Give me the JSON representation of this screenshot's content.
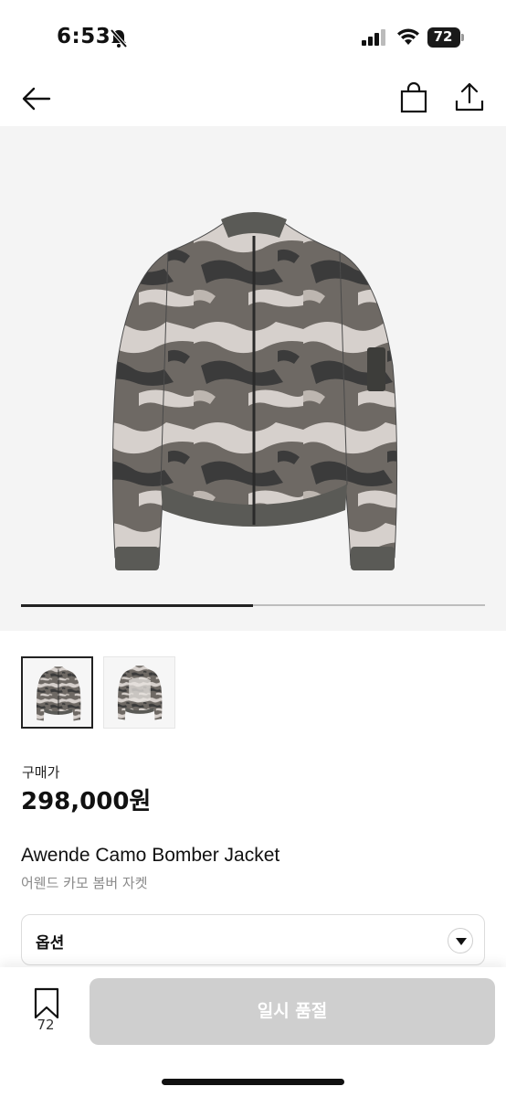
{
  "status_bar": {
    "time": "6:53",
    "battery": "72",
    "icons": [
      "bell-slash-icon",
      "signal-icon",
      "wifi-icon",
      "battery-icon"
    ]
  },
  "nav": {
    "icons": [
      "arrow-left-icon",
      "shopping-bag-icon",
      "share-icon"
    ]
  },
  "gallery": {
    "progress_fraction": 0.5,
    "thumbnail_count": 2,
    "active_index": 0
  },
  "product": {
    "price_label": "구매가",
    "price": "298,000원",
    "name": "Awende Camo Bomber Jacket",
    "subtitle": "어웬드 카모 봄버 자켓"
  },
  "option": {
    "label": "옵션"
  },
  "bottom_bar": {
    "bookmark_count": "72",
    "action_label": "일시 품절"
  },
  "colors": {
    "hero_background": "#f4f4f4",
    "disabled_button": "#cfcfcf",
    "camo_dark": "#3b3b3b",
    "camo_mid": "#6e6964",
    "camo_light": "#d6d0cc"
  }
}
